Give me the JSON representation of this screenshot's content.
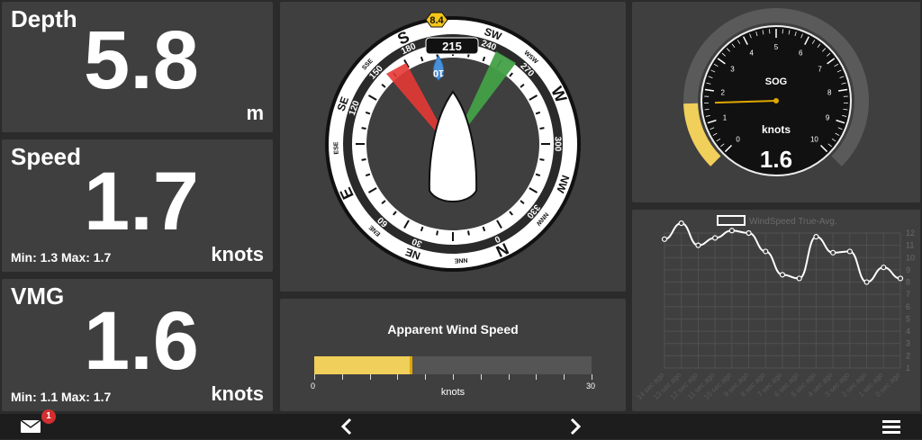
{
  "depth": {
    "label": "Depth",
    "value": "5.8",
    "unit": "m"
  },
  "speed": {
    "label": "Speed",
    "value": "1.7",
    "unit": "knots",
    "minmax": "Min: 1.3 Max: 1.7"
  },
  "vmg": {
    "label": "VMG",
    "value": "1.6",
    "unit": "knots",
    "minmax": "Min: 1.1 Max: 1.7"
  },
  "compass": {
    "heading": "215",
    "tws": "8.4",
    "twa": "10",
    "cardinals": [
      "S",
      "SW",
      "W",
      "NW",
      "N",
      "NE",
      "E",
      "SE"
    ],
    "intercardinals": [
      "SSE",
      "WSW",
      "NNW",
      "NNE",
      "ENE",
      "ESE"
    ],
    "degree_labels": [
      "180",
      "150",
      "120",
      "240",
      "270",
      "300",
      "330",
      "0",
      "30",
      "60"
    ]
  },
  "aws": {
    "title": "Apparent Wind Speed",
    "unit": "knots",
    "min": "0",
    "max": "30",
    "value": 10.5
  },
  "sog": {
    "label": "SOG",
    "unit": "knots",
    "value": "1.6",
    "ticks": [
      "0",
      "1",
      "2",
      "3",
      "4",
      "5",
      "6",
      "7",
      "8",
      "9",
      "10"
    ],
    "needle_value": 1.6,
    "max": 10
  },
  "wind_chart": {
    "legend": "WindSpeed True-Avg.",
    "y_ticks": [
      "12",
      "11",
      "10",
      "9",
      "8",
      "7",
      "6",
      "5",
      "4",
      "3",
      "2",
      "1"
    ],
    "x_labels": [
      "14 sec ago",
      "13 sec ago",
      "12 sec ago",
      "11 sec ago",
      "10 sec ago",
      "9 sec ago",
      "8 sec ago",
      "7 sec ago",
      "6 sec ago",
      "5 sec ago",
      "4 sec ago",
      "3 sec ago",
      "2 sec ago",
      "1 sec ago",
      "0 sec ago"
    ]
  },
  "chart_data": {
    "type": "line",
    "x": [
      "14 sec ago",
      "13 sec ago",
      "12 sec ago",
      "11 sec ago",
      "10 sec ago",
      "9 sec ago",
      "8 sec ago",
      "7 sec ago",
      "6 sec ago",
      "5 sec ago",
      "4 sec ago",
      "3 sec ago",
      "2 sec ago",
      "1 sec ago",
      "0 sec ago"
    ],
    "series": [
      {
        "name": "WindSpeed True-Avg.",
        "values": [
          11.5,
          12.8,
          11.0,
          11.6,
          12.2,
          12.0,
          10.5,
          8.6,
          8.3,
          11.7,
          10.4,
          10.5,
          8.0,
          9.2,
          8.3
        ]
      }
    ],
    "ylim": [
      1,
      12
    ]
  },
  "footer": {
    "notification_count": "1"
  }
}
